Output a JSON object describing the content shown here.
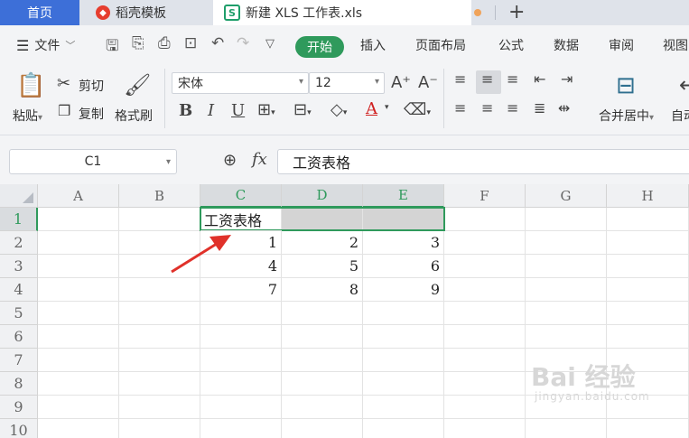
{
  "tabs": {
    "home": "首页",
    "templates": "稻壳模板",
    "document": "新建 XLS 工作表.xls",
    "new_tab": "+"
  },
  "menu": {
    "file": "文件",
    "start": "开始",
    "items": [
      "插入",
      "页面布局",
      "公式",
      "数据",
      "审阅",
      "视图"
    ]
  },
  "ribbon": {
    "paste": "粘贴",
    "cut": "剪切",
    "copy": "复制",
    "format_painter": "格式刷",
    "font_name": "宋体",
    "font_size": "12",
    "bold": "B",
    "italic": "I",
    "underline": "U",
    "font_color_letter": "A",
    "merge_center": "合并居中",
    "auto": "自动"
  },
  "formula_bar": {
    "name_box": "C1",
    "fx": "fx",
    "content": "工资表格"
  },
  "sheet": {
    "columns": [
      "A",
      "B",
      "C",
      "D",
      "E",
      "F",
      "G",
      "H"
    ],
    "rows": [
      "1",
      "2",
      "3",
      "4",
      "5",
      "6",
      "7",
      "8",
      "9",
      "10"
    ],
    "selected_cell": "C1",
    "title_cell": "工资表格",
    "data": [
      [
        "1",
        "2",
        "3"
      ],
      [
        "4",
        "5",
        "6"
      ],
      [
        "7",
        "8",
        "9"
      ]
    ]
  },
  "colors": {
    "accent_green": "#2f9a5c",
    "home_tab_blue": "#3d6fd8",
    "arrow_red": "#e0312a"
  },
  "watermark": {
    "brand": "Bai 经验",
    "url": "jingyan.baidu.com"
  }
}
